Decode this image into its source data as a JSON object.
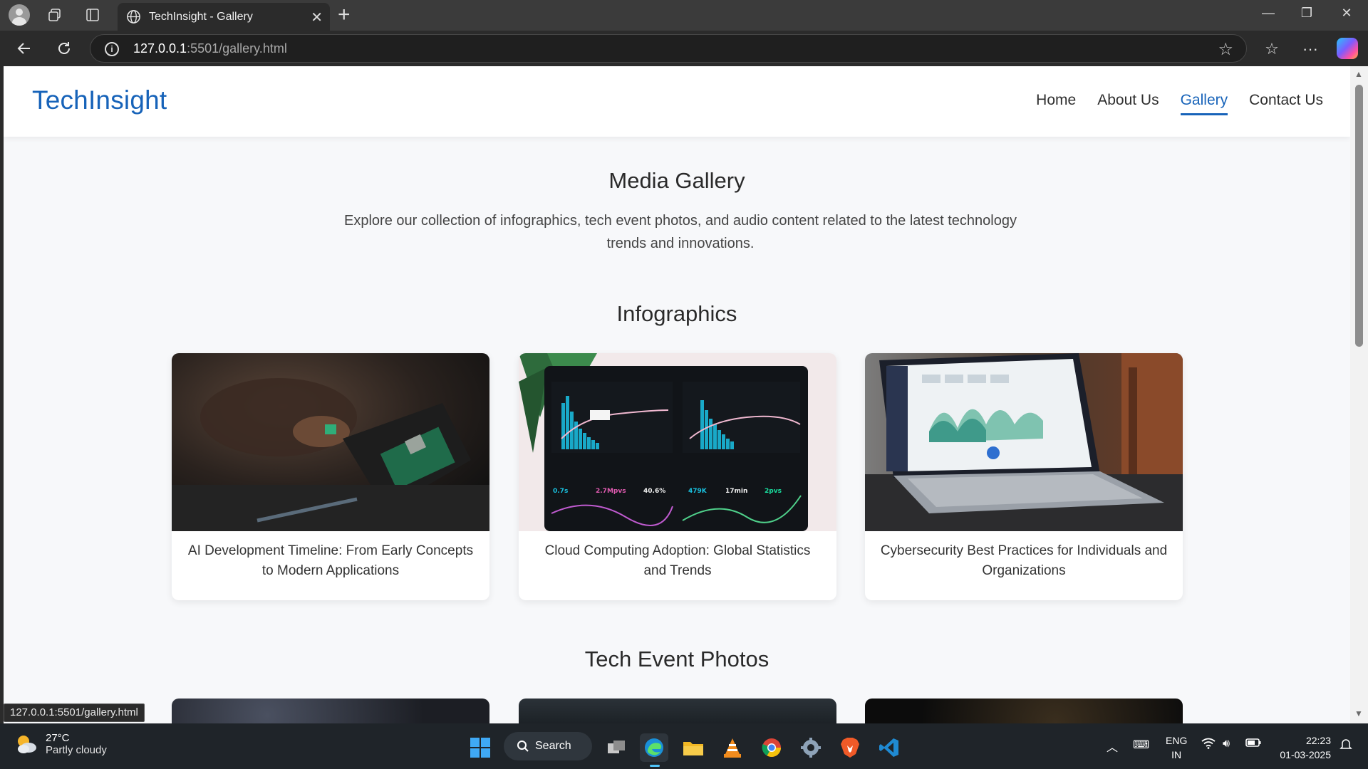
{
  "browser": {
    "tab_title": "TechInsight - Gallery",
    "url_host": "127.0.0.1",
    "url_path": ":5501/gallery.html",
    "status_url": "127.0.0.1:5501/gallery.html"
  },
  "site": {
    "logo": "TechInsight",
    "nav": [
      {
        "label": "Home",
        "active": false
      },
      {
        "label": "About Us",
        "active": false
      },
      {
        "label": "Gallery",
        "active": true
      },
      {
        "label": "Contact Us",
        "active": false
      }
    ]
  },
  "main": {
    "title": "Media Gallery",
    "intro": "Explore our collection of infographics, tech event photos, and audio content related to the latest technology trends and innovations.",
    "infographics": {
      "heading": "Infographics",
      "cards": [
        {
          "caption": "AI Development Timeline: From Early Concepts to Modern Applications"
        },
        {
          "caption": "Cloud Computing Adoption: Global Statistics and Trends"
        },
        {
          "caption": "Cybersecurity Best Practices for Individuals and Organizations"
        }
      ]
    },
    "events": {
      "heading": "Tech Event Photos"
    }
  },
  "taskbar": {
    "weather_temp": "27°C",
    "weather_cond": "Partly cloudy",
    "search_label": "Search",
    "lang_1": "ENG",
    "lang_2": "IN",
    "time": "22:23",
    "date": "01-03-2025"
  },
  "colors": {
    "accent": "#1763b9",
    "page_bg": "#f7f8fa",
    "taskbar_bg": "#1f2429"
  }
}
